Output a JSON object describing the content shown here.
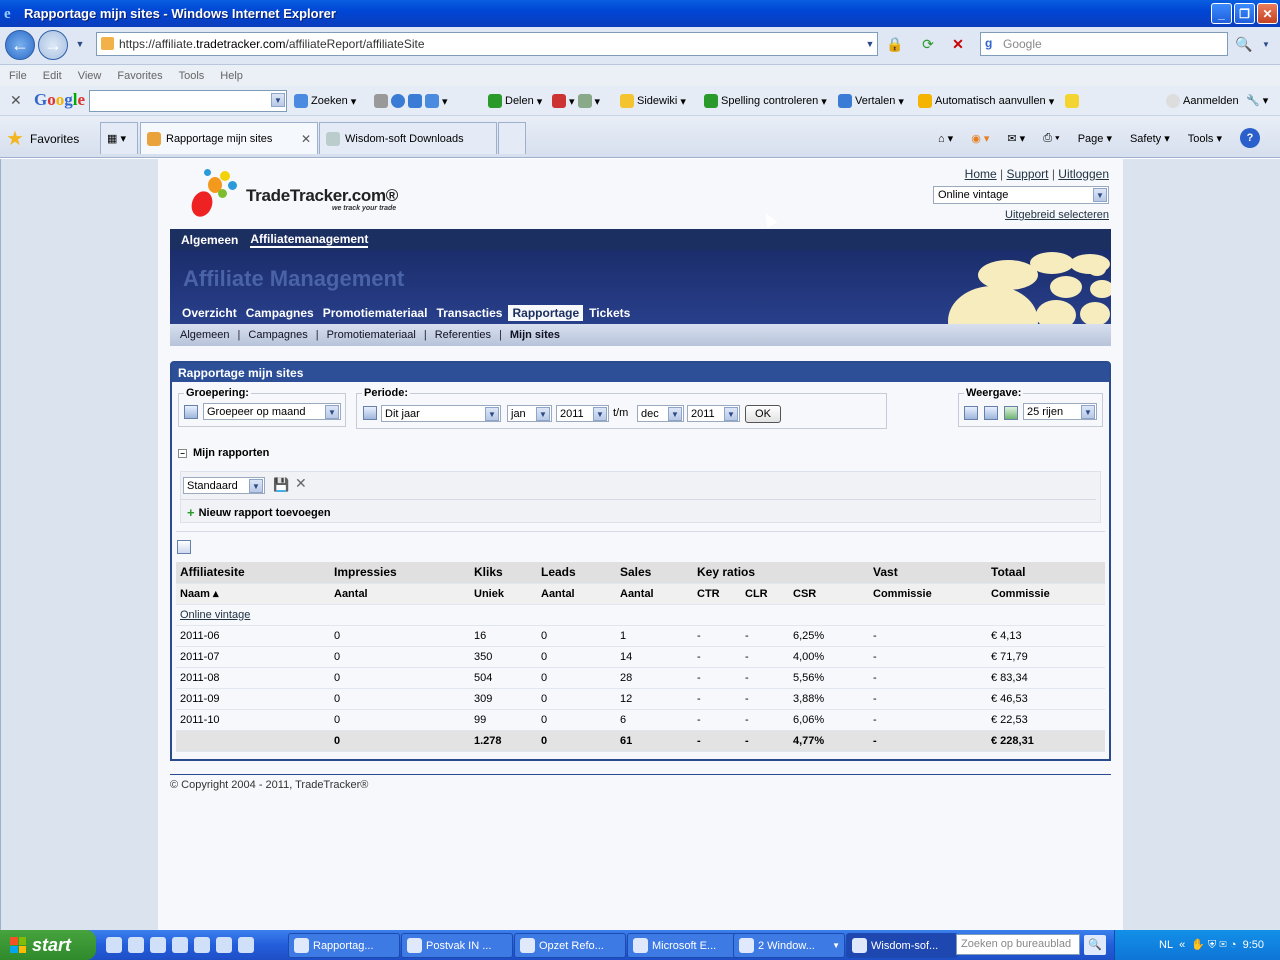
{
  "window": {
    "title": "Rapportage mijn sites - Windows Internet Explorer"
  },
  "address": {
    "prefix": "https://affiliate.",
    "host": "tradetracker.com",
    "path": "/affiliateReport/affiliateSite",
    "search_placeholder": "Google"
  },
  "menu": [
    "File",
    "Edit",
    "View",
    "Favorites",
    "Tools",
    "Help"
  ],
  "google_toolbar": {
    "logo": "Google",
    "zoeken": "Zoeken",
    "delen": "Delen",
    "sidewiki": "Sidewiki",
    "spelling": "Spelling controleren",
    "vertalen": "Vertalen",
    "auto": "Automatisch aanvullen",
    "aanmelden": "Aanmelden"
  },
  "tabs": {
    "favorites": "Favorites",
    "tab1": "Rapportage mijn sites",
    "tab2": "Wisdom-soft Downloads",
    "page": "Page",
    "safety": "Safety",
    "tools": "Tools"
  },
  "site": {
    "brand": "TradeTracker.com®",
    "tagline": "we track your trade",
    "links": {
      "home": "Home",
      "support": "Support",
      "logout": "Uitloggen"
    },
    "site_select": "Online vintage",
    "advanced": "Uitgebreid selecteren",
    "topnav": [
      "Algemeen",
      "Affiliatemanagement"
    ],
    "banner_title": "Affiliate Management",
    "mainnav": [
      "Overzicht",
      "Campagnes",
      "Promotiemateriaal",
      "Transacties",
      "Rapportage",
      "Tickets"
    ],
    "subnav": [
      "Algemeen",
      "Campagnes",
      "Promotiemateriaal",
      "Referenties",
      "Mijn sites"
    ]
  },
  "report": {
    "title": "Rapportage mijn sites",
    "groepering_label": "Groepering:",
    "groepering_value": "Groepeer op maand",
    "periode_label": "Periode:",
    "periode_value": "Dit jaar",
    "from_month": "jan",
    "from_year": "2011",
    "tm": "t/m",
    "to_month": "dec",
    "to_year": "2011",
    "ok": "OK",
    "weergave_label": "Weergave:",
    "rows_value": "25 rijen",
    "mijn_rapporten": "Mijn rapporten",
    "standaard": "Standaard",
    "nieuw": "Nieuw rapport toevoegen"
  },
  "table": {
    "h1": [
      "Affiliatesite",
      "Impressies",
      "Kliks",
      "Leads",
      "Sales",
      "Key ratios",
      "Vast",
      "Totaal"
    ],
    "h2": [
      "Naam ▴",
      "Aantal",
      "Uniek",
      "Aantal",
      "Aantal",
      "CTR",
      "CLR",
      "CSR",
      "Commissie",
      "Commissie"
    ],
    "group": "Online vintage",
    "rows": [
      [
        "2011-06",
        "0",
        "16",
        "0",
        "1",
        "-",
        "-",
        "6,25%",
        "-",
        "€ 4,13"
      ],
      [
        "2011-07",
        "0",
        "350",
        "0",
        "14",
        "-",
        "-",
        "4,00%",
        "-",
        "€ 71,79"
      ],
      [
        "2011-08",
        "0",
        "504",
        "0",
        "28",
        "-",
        "-",
        "5,56%",
        "-",
        "€ 83,34"
      ],
      [
        "2011-09",
        "0",
        "309",
        "0",
        "12",
        "-",
        "-",
        "3,88%",
        "-",
        "€ 46,53"
      ],
      [
        "2011-10",
        "0",
        "99",
        "0",
        "6",
        "-",
        "-",
        "6,06%",
        "-",
        "€ 22,53"
      ]
    ],
    "total": [
      "",
      "0",
      "1.278",
      "0",
      "61",
      "-",
      "-",
      "4,77%",
      "-",
      "€ 228,31"
    ]
  },
  "footer": "© Copyright 2004 - 2011, TradeTracker®",
  "taskbar": {
    "start": "start",
    "buttons": [
      "Rapportag...",
      "Postvak IN ...",
      "Opzet Refo...",
      "Microsoft E...",
      "2 Window...",
      "Wisdom-sof..."
    ],
    "search_placeholder": "Zoeken op bureaublad",
    "lang": "NL",
    "clock": "9:50"
  }
}
